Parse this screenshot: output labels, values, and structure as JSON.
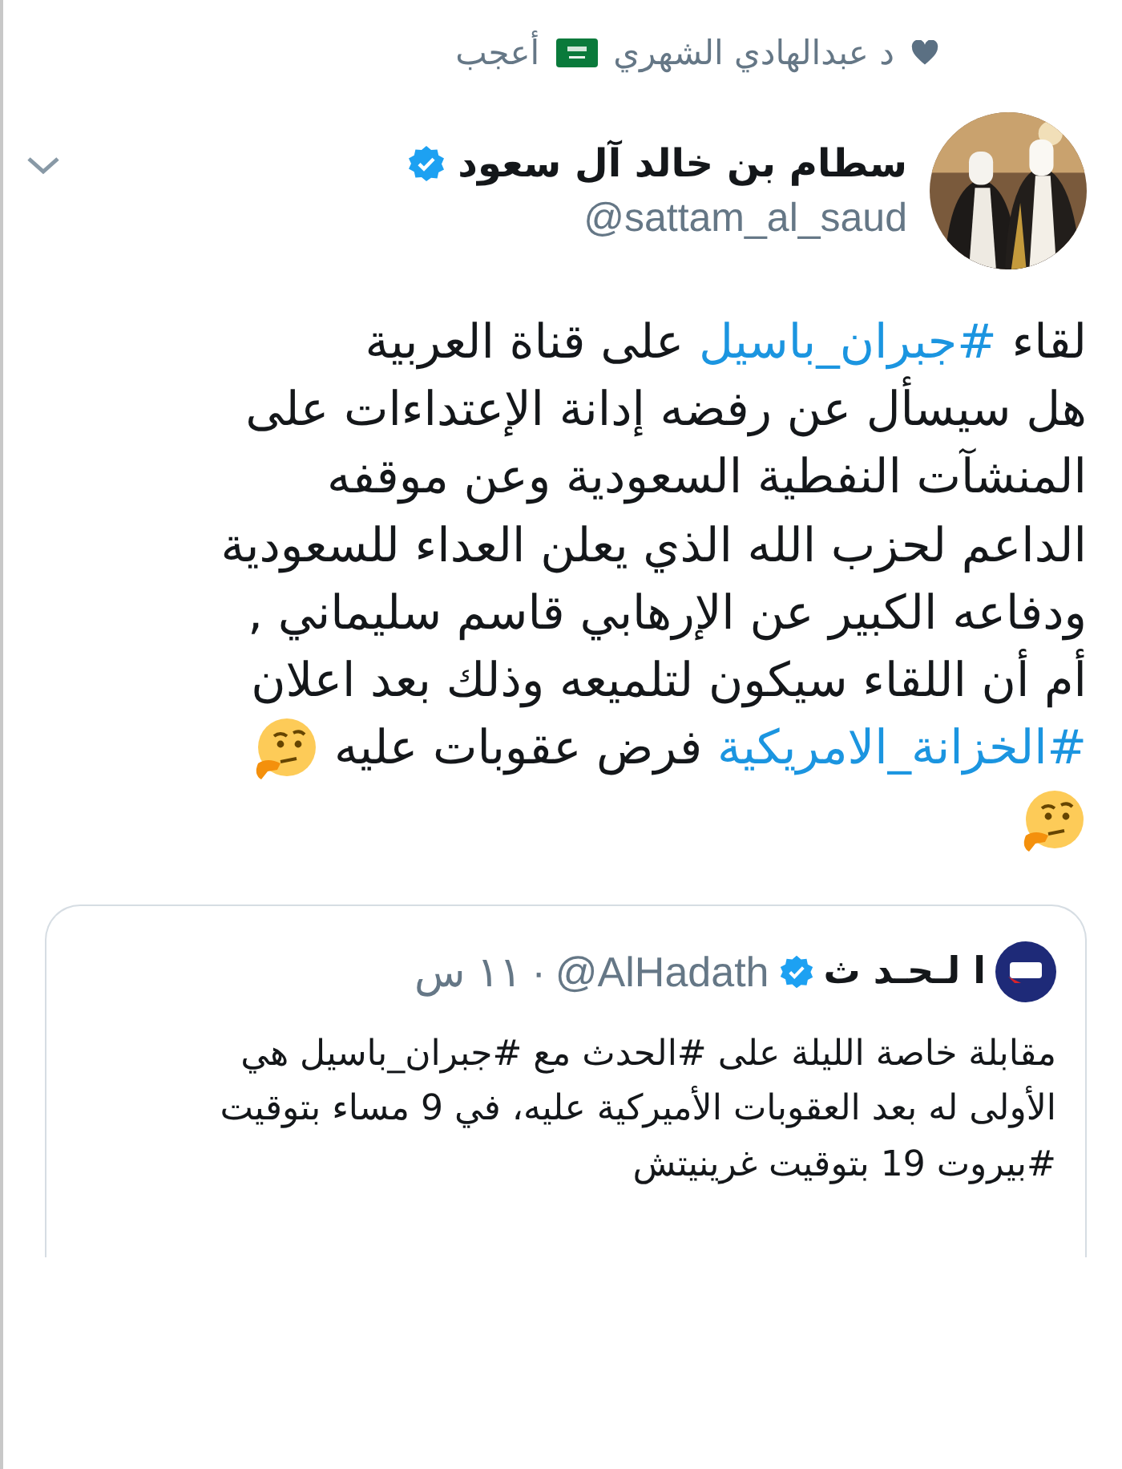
{
  "social_context": {
    "user": "د عبدالهادي الشهري",
    "action": "أعجب"
  },
  "tweet": {
    "author": {
      "name": "سطام بن خالد آل سعود",
      "verified": true,
      "handle": "@sattam_al_saud"
    },
    "lines": [
      [
        {
          "kind": "text",
          "text": "لقاء "
        },
        {
          "kind": "hashtag",
          "text": "#جبران_باسيل"
        },
        {
          "kind": "text",
          "text": " على قناة العربية"
        }
      ],
      [
        {
          "kind": "text",
          "text": "هل سيسأل عن رفضه إدانة الإعتداءات على"
        }
      ],
      [
        {
          "kind": "text",
          "text": "المنشآت النفطية السعودية وعن موقفه"
        }
      ],
      [
        {
          "kind": "text",
          "text": "الداعم لحزب الله الذي يعلن العداء للسعودية"
        }
      ],
      [
        {
          "kind": "text",
          "text": "ودفاعه الكبير عن الإرهابي قاسم سليماني ,"
        }
      ],
      [
        {
          "kind": "text",
          "text": "أم أن اللقاء سيكون لتلميعه وذلك بعد اعلان"
        }
      ],
      [
        {
          "kind": "hashtag",
          "text": "#الخزانة_الامريكية"
        },
        {
          "kind": "text",
          "text": " فرض عقوبات عليه "
        },
        {
          "kind": "emoji"
        }
      ],
      [
        {
          "kind": "emoji"
        }
      ]
    ],
    "quoted": {
      "name": "ا لـحـد ث",
      "verified": true,
      "handle": "@AlHadath",
      "separator": "·",
      "time": "١١ س",
      "lines": [
        "مقابلة خاصة الليلة على #الحدث مع #جبران_باسيل هي",
        "الأولى له بعد العقوبات الأميركية عليه، في 9 مساء بتوقيت",
        "#بيروت 19 بتوقيت غرينيتش"
      ]
    }
  }
}
